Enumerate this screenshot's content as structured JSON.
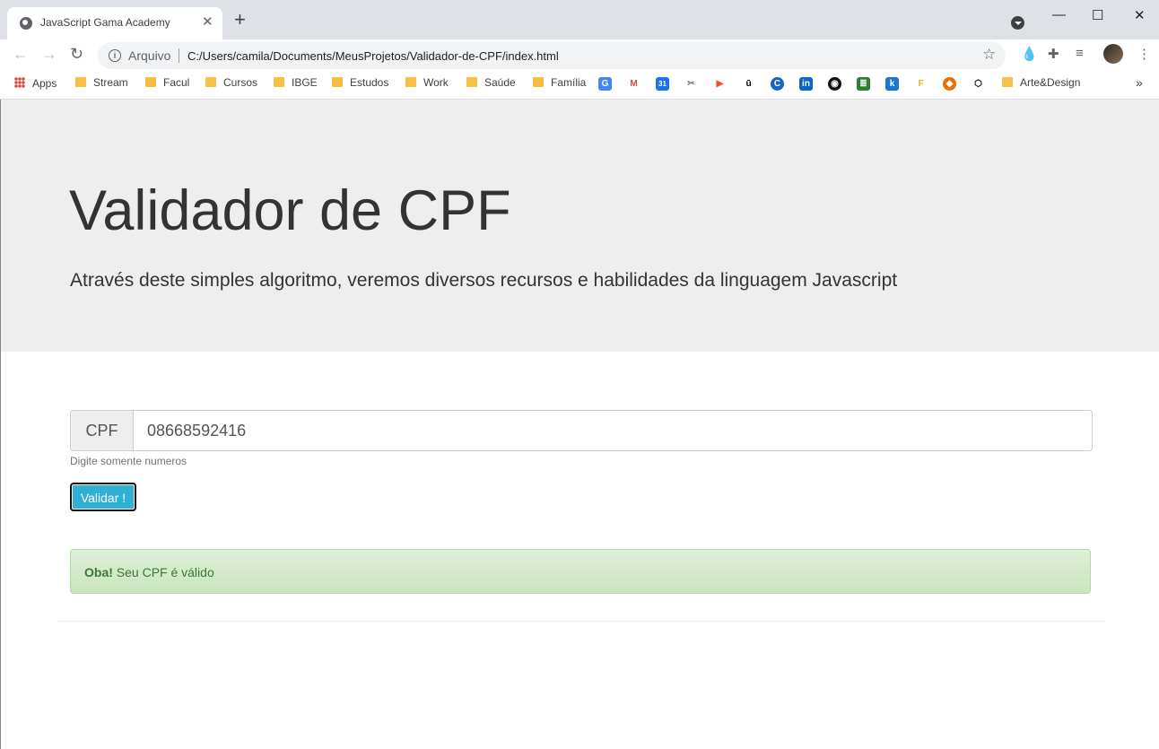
{
  "browser": {
    "tab_title": "JavaScript Gama Academy",
    "tab_close": "✕",
    "new_tab": "+",
    "window_controls": {
      "minimize": "—",
      "maximize": "☐",
      "close": "✕"
    },
    "nav": {
      "back": "←",
      "forward": "→",
      "reload": "↻"
    },
    "address": {
      "scheme_label": "Arquivo",
      "url": "C:/Users/camila/Documents/MeusProjetos/Validador-de-CPF/index.html"
    },
    "toolbar_icons": [
      "drop-icon",
      "puzzle-icon",
      "media-icon",
      "avatar",
      "menu-icon"
    ],
    "bookmarks": [
      {
        "label": "Apps",
        "icon": "apps-grid-icon"
      },
      {
        "label": "Stream",
        "icon": "folder-icon"
      },
      {
        "label": "Facul",
        "icon": "folder-icon"
      },
      {
        "label": "Cursos",
        "icon": "folder-icon"
      },
      {
        "label": "IBGE",
        "icon": "folder-icon"
      },
      {
        "label": "Estudos",
        "icon": "folder-icon"
      },
      {
        "label": "Work",
        "icon": "folder-icon"
      },
      {
        "label": "Saúde",
        "icon": "folder-icon"
      },
      {
        "label": "Família",
        "icon": "folder-icon"
      },
      {
        "label": "Arte&Design",
        "icon": "folder-icon"
      }
    ],
    "bookmark_overflow": "»"
  },
  "page": {
    "title": "Validador de CPF",
    "lead": "Através deste simples algoritmo, veremos diversos recursos e habilidades da linguagem Javascript",
    "form": {
      "addon": "CPF",
      "value": "08668592416",
      "help": "Digite somente numeros",
      "button": "Validar !"
    },
    "alert": {
      "strong": "Oba!",
      "text": " Seu CPF é válido"
    }
  },
  "colors": {
    "jumbotron": "#eeeeee",
    "button": "#31b0d5",
    "alert_bg": "#dff0d8",
    "alert_text": "#3c763d"
  }
}
